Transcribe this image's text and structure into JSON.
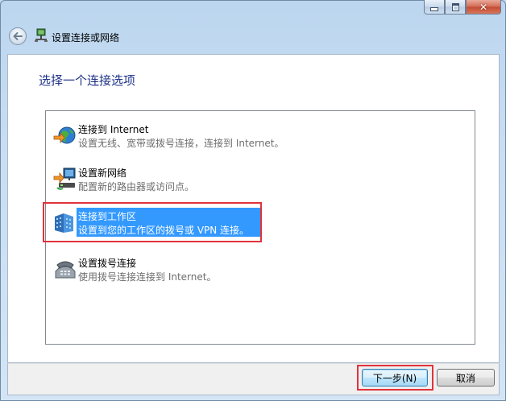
{
  "window": {
    "title": "设置连接或网络",
    "heading": "选择一个连接选项",
    "caption_close": "✕"
  },
  "options": [
    {
      "title": "连接到 Internet",
      "description": "设置无线、宽带或拨号连接，连接到 Internet。",
      "icon": "globe-icon"
    },
    {
      "title": "设置新网络",
      "description": "配置新的路由器或访问点。",
      "icon": "network-setup-icon"
    },
    {
      "title": "连接到工作区",
      "description": "设置到您的工作区的拨号或 VPN 连接。",
      "icon": "workplace-icon",
      "selected": true
    },
    {
      "title": "设置拨号连接",
      "description": "使用拨号连接连接到 Internet。",
      "icon": "telephone-icon"
    }
  ],
  "buttons": {
    "next": "下一步(N)",
    "cancel": "取消"
  },
  "colors": {
    "heading": "#1e3287",
    "selection": "#3399ff",
    "highlight_box": "#e0333b"
  }
}
